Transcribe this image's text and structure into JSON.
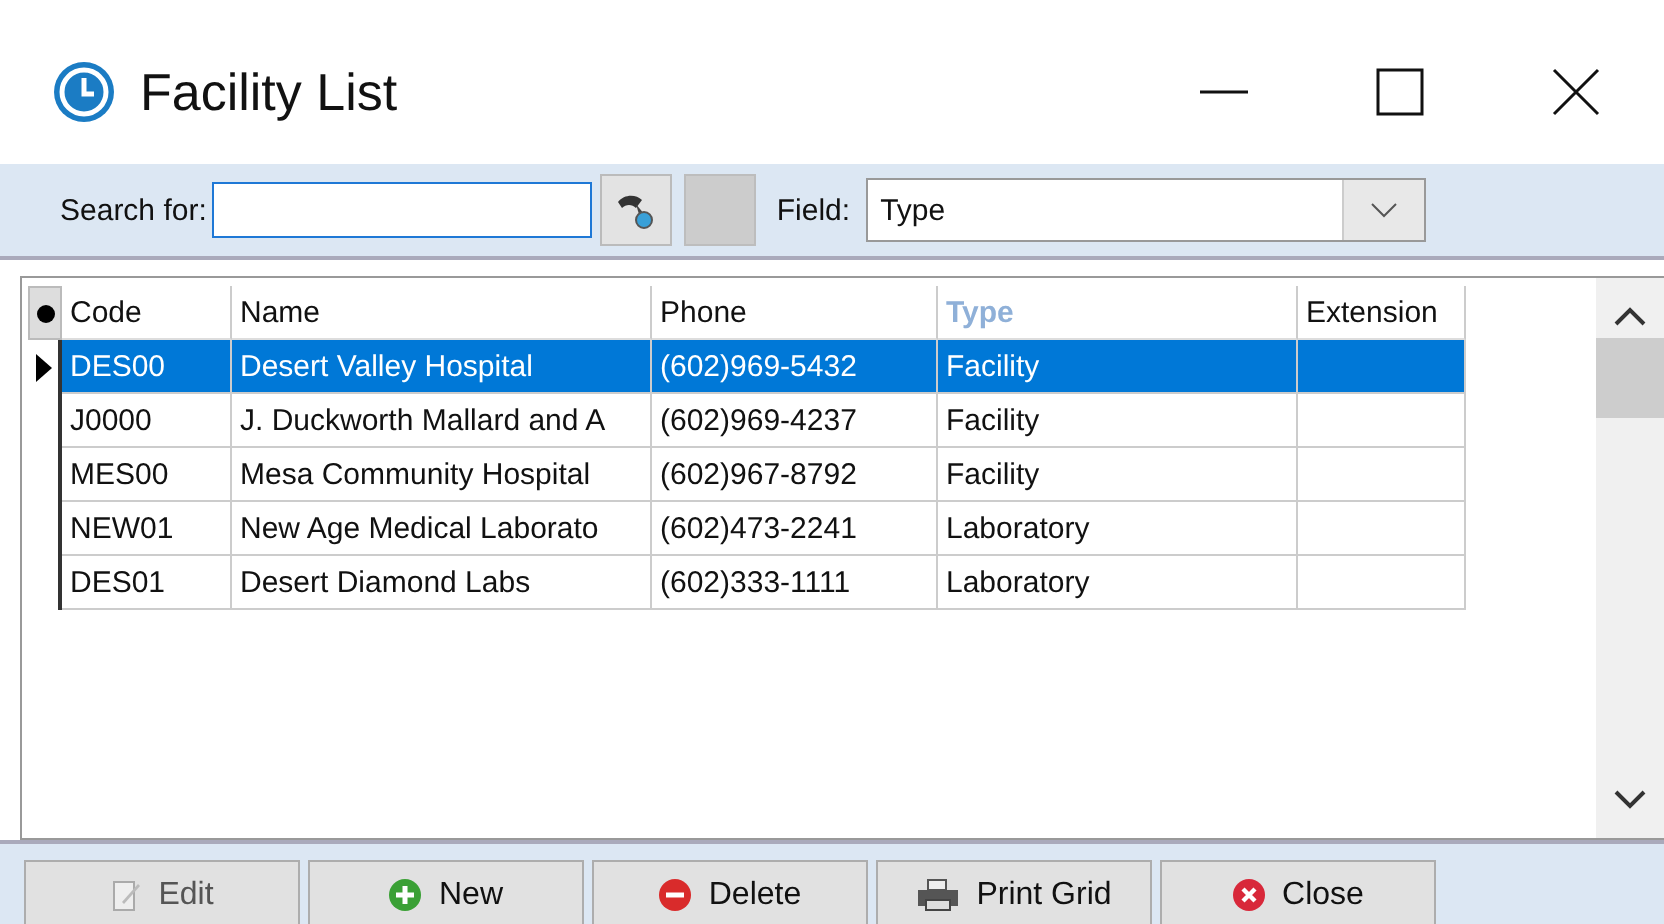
{
  "window": {
    "title": "Facility List"
  },
  "search": {
    "label": "Search for:"
  },
  "field": {
    "label": "Field:",
    "value": "Type"
  },
  "table": {
    "columns": [
      {
        "label": "Code",
        "sorted": false
      },
      {
        "label": "Name",
        "sorted": false
      },
      {
        "label": "Phone",
        "sorted": false
      },
      {
        "label": "Type",
        "sorted": true
      },
      {
        "label": "Extension",
        "sorted": false
      }
    ],
    "rows": [
      {
        "cells": [
          "DES00",
          "Desert Valley Hospital",
          "(602)969-5432",
          "Facility",
          ""
        ],
        "selected": true
      },
      {
        "cells": [
          "J0000",
          "J. Duckworth Mallard and A",
          "(602)969-4237",
          "Facility",
          ""
        ],
        "selected": false
      },
      {
        "cells": [
          "MES00",
          "Mesa Community Hospital",
          "(602)967-8792",
          "Facility",
          ""
        ],
        "selected": false
      },
      {
        "cells": [
          "NEW01",
          "New Age Medical Laborato",
          "(602)473-2241",
          "Laboratory",
          ""
        ],
        "selected": false
      },
      {
        "cells": [
          "DES01",
          "Desert Diamond Labs",
          "(602)333-1111",
          "Laboratory",
          ""
        ],
        "selected": false
      }
    ]
  },
  "buttons": [
    {
      "label": "Edit",
      "kind": "edit",
      "disabled": true
    },
    {
      "label": "New",
      "kind": "new",
      "disabled": false
    },
    {
      "label": "Delete",
      "kind": "delete",
      "disabled": false
    },
    {
      "label": "Print Grid",
      "kind": "print",
      "disabled": false
    },
    {
      "label": "Close",
      "kind": "close",
      "disabled": false
    }
  ]
}
